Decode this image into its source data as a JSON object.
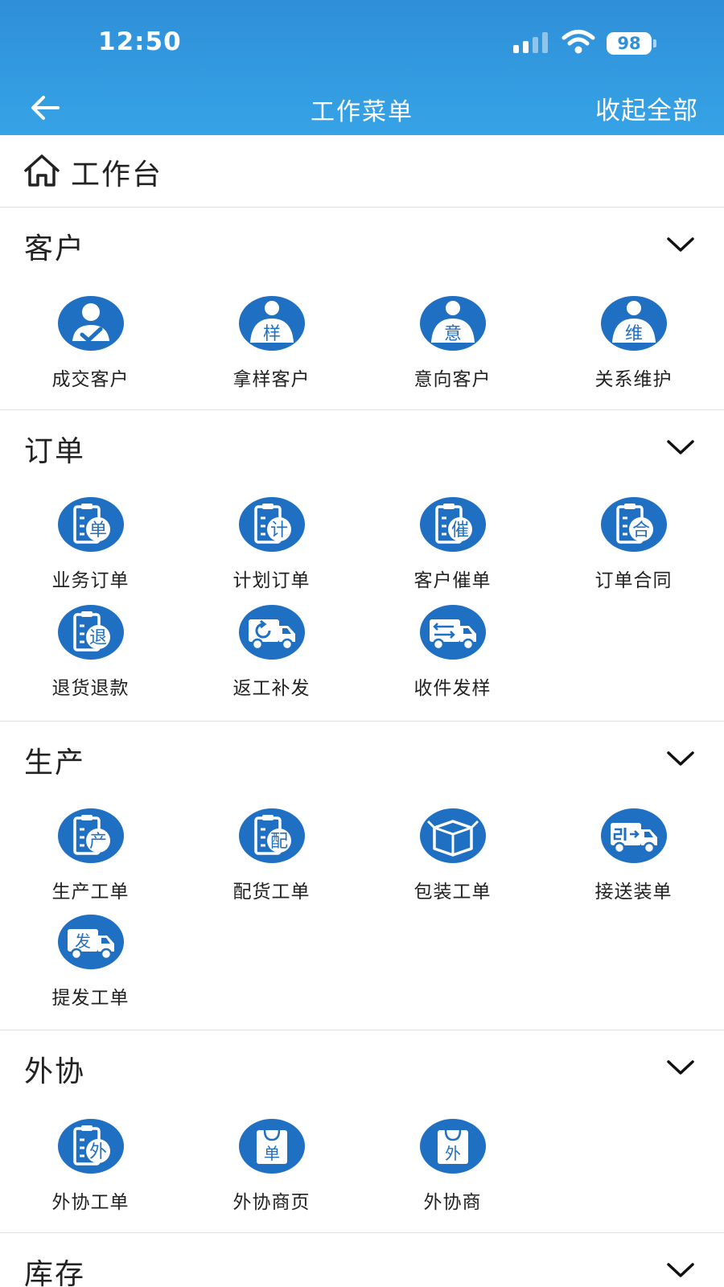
{
  "status": {
    "time": "12:50",
    "battery": "98"
  },
  "nav": {
    "title": "工作菜单",
    "collapse_all": "收起全部"
  },
  "workbench": {
    "title": "工作台"
  },
  "sections": [
    {
      "title": "客户",
      "items": [
        {
          "label": "成交客户",
          "glyph": ""
        },
        {
          "label": "拿样客户",
          "glyph": "样"
        },
        {
          "label": "意向客户",
          "glyph": "意"
        },
        {
          "label": "关系维护",
          "glyph": "维"
        }
      ]
    },
    {
      "title": "订单",
      "items": [
        {
          "label": "业务订单",
          "glyph": "单"
        },
        {
          "label": "计划订单",
          "glyph": "计"
        },
        {
          "label": "客户催单",
          "glyph": "催"
        },
        {
          "label": "订单合同",
          "glyph": "合"
        },
        {
          "label": "退货退款",
          "glyph": "退"
        },
        {
          "label": "返工补发",
          "glyph": ""
        },
        {
          "label": "收件发样",
          "glyph": ""
        }
      ]
    },
    {
      "title": "生产",
      "items": [
        {
          "label": "生产工单",
          "glyph": "产"
        },
        {
          "label": "配货工单",
          "glyph": "配"
        },
        {
          "label": "包装工单",
          "glyph": ""
        },
        {
          "label": "接送装单",
          "glyph": ""
        },
        {
          "label": "提发工单",
          "glyph": "发"
        }
      ]
    },
    {
      "title": "外协",
      "items": [
        {
          "label": "外协工单",
          "glyph": "外"
        },
        {
          "label": "外协商页",
          "glyph": "单"
        },
        {
          "label": "外协商",
          "glyph": "外"
        }
      ]
    },
    {
      "title": "库存",
      "items": []
    }
  ],
  "colors": {
    "header": "#2f8fd8",
    "icon": "#1f6fc2",
    "icon_light": "#4a9be0"
  }
}
